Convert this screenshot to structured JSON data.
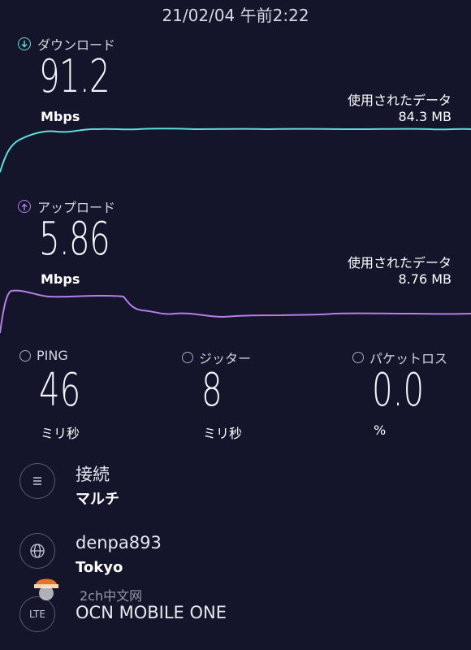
{
  "timestamp": "21/02/04 午前2:22",
  "download": {
    "label": "ダウンロード",
    "value": "91.2",
    "unit": "Mbps",
    "data_label": "使用されたデータ",
    "data_value": "84.3 MB",
    "color": "#5ee0dc"
  },
  "upload": {
    "label": "アップロード",
    "value": "5.86",
    "unit": "Mbps",
    "data_label": "使用されたデータ",
    "data_value": "8.76 MB",
    "color": "#b57fe6"
  },
  "metrics": [
    {
      "label": "PING",
      "value": "46",
      "unit": "ミリ秒",
      "icon": "ping-icon"
    },
    {
      "label": "ジッター",
      "value": "8",
      "unit": "ミリ秒",
      "icon": "jitter-icon"
    },
    {
      "label": "パケットロス",
      "value": "0.0",
      "unit": "%",
      "icon": "packet-loss-icon"
    }
  ],
  "connection": {
    "primary": "接続",
    "secondary": "マルチ"
  },
  "server": {
    "primary": "denpa893",
    "secondary": "Tokyo"
  },
  "provider": {
    "primary": "OCN MOBILE ONE",
    "icon_text": "LTE"
  },
  "watermark": {
    "text": "2ch中文网"
  }
}
